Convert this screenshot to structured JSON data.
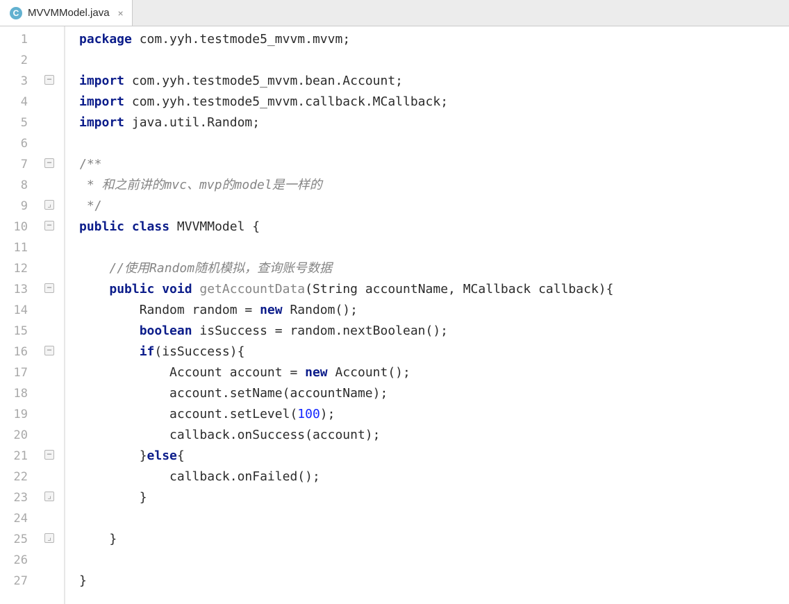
{
  "tab": {
    "icon_letter": "C",
    "filename": "MVVMModel.java",
    "close_glyph": "×"
  },
  "gutter": {
    "start": 1,
    "end": 27
  },
  "code": {
    "lines": [
      {
        "indent": 0,
        "tokens": [
          [
            "kw",
            "package"
          ],
          [
            "sep",
            " "
          ],
          [
            "pkg",
            "com.yyh.testmode5_mvvm.mvvm"
          ],
          [
            "sep",
            ";"
          ]
        ]
      },
      {
        "indent": 0,
        "tokens": []
      },
      {
        "indent": 0,
        "tokens": [
          [
            "kw",
            "import"
          ],
          [
            "sep",
            " "
          ],
          [
            "pkg",
            "com.yyh.testmode5_mvvm.bean.Account"
          ],
          [
            "sep",
            ";"
          ]
        ]
      },
      {
        "indent": 0,
        "tokens": [
          [
            "kw",
            "import"
          ],
          [
            "sep",
            " "
          ],
          [
            "pkg",
            "com.yyh.testmode5_mvvm.callback.MCallback"
          ],
          [
            "sep",
            ";"
          ]
        ]
      },
      {
        "indent": 0,
        "tokens": [
          [
            "kw",
            "import"
          ],
          [
            "sep",
            " "
          ],
          [
            "pkg",
            "java.util.Random"
          ],
          [
            "sep",
            ";"
          ]
        ]
      },
      {
        "indent": 0,
        "tokens": []
      },
      {
        "indent": 0,
        "tokens": [
          [
            "cmt",
            "/**"
          ]
        ]
      },
      {
        "indent": 0,
        "tokens": [
          [
            "cmt",
            " * "
          ],
          [
            "muted",
            "和之前讲的mvc、mvp的model是一样的"
          ]
        ]
      },
      {
        "indent": 0,
        "tokens": [
          [
            "cmt",
            " */"
          ]
        ]
      },
      {
        "indent": 0,
        "tokens": [
          [
            "kw",
            "public class"
          ],
          [
            "sep",
            " "
          ],
          [
            "ident",
            "MVVMModel"
          ],
          [
            "sep",
            " {"
          ]
        ]
      },
      {
        "indent": 0,
        "tokens": []
      },
      {
        "indent": 1,
        "tokens": [
          [
            "muted",
            "//使用Random随机模拟，查询账号数据"
          ]
        ]
      },
      {
        "indent": 1,
        "tokens": [
          [
            "kw",
            "public void"
          ],
          [
            "sep",
            " "
          ],
          [
            "def",
            "getAccountData"
          ],
          [
            "sep",
            "(String accountName, MCallback callback){"
          ]
        ]
      },
      {
        "indent": 2,
        "tokens": [
          [
            "ident",
            "Random random = "
          ],
          [
            "kw",
            "new"
          ],
          [
            "sep",
            " Random();"
          ]
        ]
      },
      {
        "indent": 2,
        "tokens": [
          [
            "kw",
            "boolean"
          ],
          [
            "sep",
            " isSuccess = random.nextBoolean();"
          ]
        ]
      },
      {
        "indent": 2,
        "tokens": [
          [
            "kw",
            "if"
          ],
          [
            "sep",
            "(isSuccess){"
          ]
        ]
      },
      {
        "indent": 3,
        "tokens": [
          [
            "ident",
            "Account account = "
          ],
          [
            "kw",
            "new"
          ],
          [
            "sep",
            " Account();"
          ]
        ]
      },
      {
        "indent": 3,
        "tokens": [
          [
            "ident",
            "account.setName(accountName);"
          ]
        ]
      },
      {
        "indent": 3,
        "tokens": [
          [
            "ident",
            "account.setLevel("
          ],
          [
            "num",
            "100"
          ],
          [
            "sep",
            ");"
          ]
        ]
      },
      {
        "indent": 3,
        "tokens": [
          [
            "ident",
            "callback.onSuccess(account);"
          ]
        ]
      },
      {
        "indent": 2,
        "tokens": [
          [
            "sep",
            "}"
          ],
          [
            "kw",
            "else"
          ],
          [
            "sep",
            "{"
          ]
        ]
      },
      {
        "indent": 3,
        "tokens": [
          [
            "ident",
            "callback.onFailed();"
          ]
        ]
      },
      {
        "indent": 2,
        "tokens": [
          [
            "sep",
            "}"
          ]
        ]
      },
      {
        "indent": 0,
        "tokens": []
      },
      {
        "indent": 1,
        "tokens": [
          [
            "sep",
            "}"
          ]
        ]
      },
      {
        "indent": 0,
        "tokens": []
      },
      {
        "indent": 0,
        "tokens": [
          [
            "sep",
            "}"
          ]
        ]
      }
    ]
  },
  "fold_markers": {
    "3": "open",
    "7": "open",
    "9": "close",
    "10": "open",
    "13": "open",
    "16": "open",
    "21": "mid",
    "23": "close",
    "25": "close"
  }
}
